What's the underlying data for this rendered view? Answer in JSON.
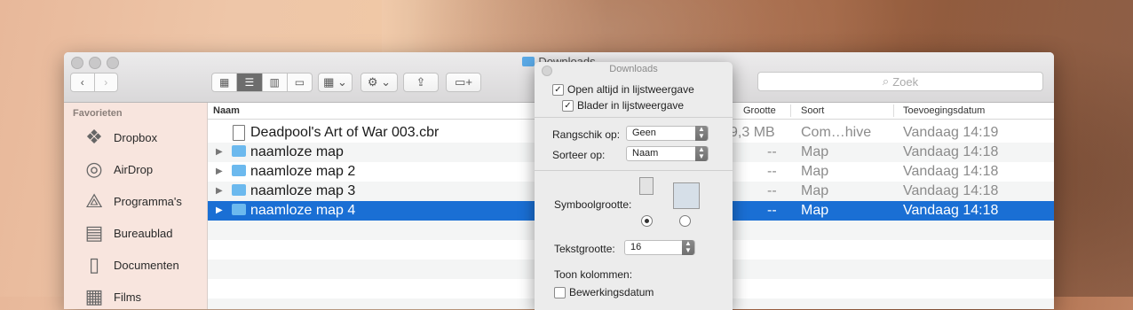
{
  "window": {
    "title": "Downloads"
  },
  "toolbar": {
    "view_modes": [
      "icon",
      "list",
      "columns",
      "cover-flow"
    ],
    "search_placeholder": "Zoek"
  },
  "sidebar": {
    "header": "Favorieten",
    "items": [
      {
        "label": "Dropbox",
        "icon": "dropbox-icon"
      },
      {
        "label": "AirDrop",
        "icon": "airdrop-icon"
      },
      {
        "label": "Programma's",
        "icon": "applications-icon"
      },
      {
        "label": "Bureaublad",
        "icon": "desktop-icon"
      },
      {
        "label": "Documenten",
        "icon": "documents-icon"
      },
      {
        "label": "Films",
        "icon": "movies-icon"
      }
    ]
  },
  "list": {
    "columns": {
      "name": "Naam",
      "size": "Grootte",
      "kind": "Soort",
      "date_added": "Toevoegingsdatum"
    },
    "rows": [
      {
        "name": "Deadpool's Art of War 003.cbr",
        "size": "9,3 MB",
        "kind": "Com…hive",
        "date": "Vandaag 14:19"
      },
      {
        "name": "naamloze map",
        "size": "--",
        "kind": "Map",
        "date": "Vandaag 14:18"
      },
      {
        "name": "naamloze map 2",
        "size": "--",
        "kind": "Map",
        "date": "Vandaag 14:18"
      },
      {
        "name": "naamloze map 3",
        "size": "--",
        "kind": "Map",
        "date": "Vandaag 14:18"
      },
      {
        "name": "naamloze map 4",
        "size": "--",
        "kind": "Map",
        "date": "Vandaag 14:18"
      }
    ]
  },
  "view_options": {
    "title": "Downloads",
    "always_list": "Open altijd in lijstweergave",
    "browse_list": "Blader in lijstweergave",
    "arrange_label": "Rangschik op:",
    "arrange_value": "Geen",
    "sort_label": "Sorteer op:",
    "sort_value": "Naam",
    "icon_size_label": "Symboolgrootte:",
    "text_size_label": "Tekstgrootte:",
    "text_size_value": "16",
    "show_columns_label": "Toon kolommen:",
    "col_modified": "Bewerkingsdatum"
  }
}
